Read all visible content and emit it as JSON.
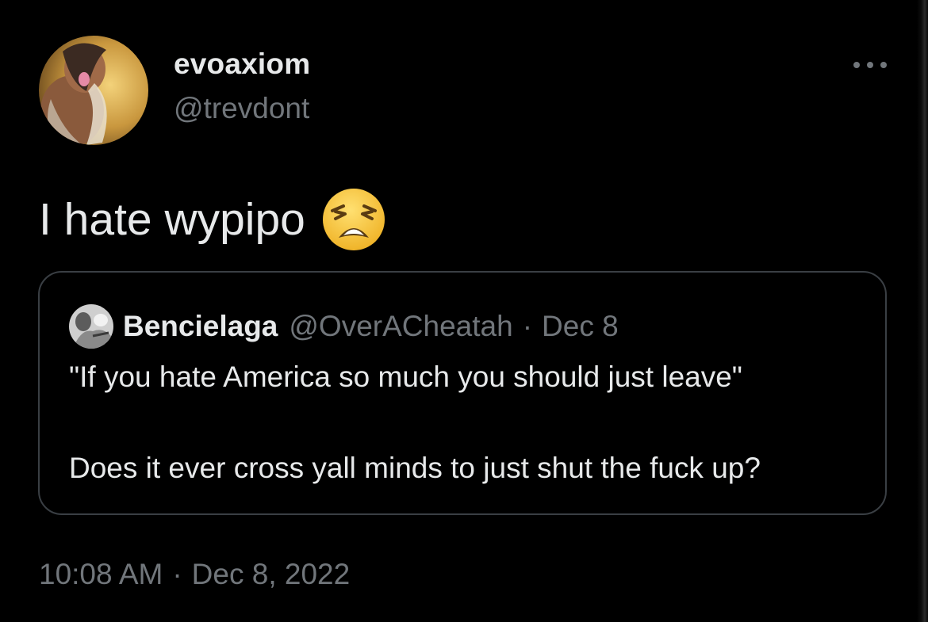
{
  "tweet": {
    "author": {
      "display_name": "evoaxiom",
      "handle": "@trevdont",
      "avatar_icon": "profile-photo"
    },
    "text": "I hate wypipo",
    "emoji": "weary-face",
    "more_icon": "more-horizontal-icon",
    "timestamp": {
      "time": "10:08 AM",
      "separator": "·",
      "date": "Dec 8, 2022"
    }
  },
  "quoted_tweet": {
    "author": {
      "display_name": "Bencielaga",
      "handle": "@OverACheatah",
      "separator": "·",
      "date": "Dec 8",
      "avatar_icon": "profile-photo"
    },
    "lines": [
      "\"If you hate America so much you should just leave\"",
      "Does it ever cross yall minds to just shut the fuck up?"
    ]
  },
  "colors": {
    "background": "#000000",
    "text_primary": "#e7e9ea",
    "text_secondary": "#71767b",
    "card_border": "#3a3f44",
    "emoji_yellow": "#f6c342"
  }
}
